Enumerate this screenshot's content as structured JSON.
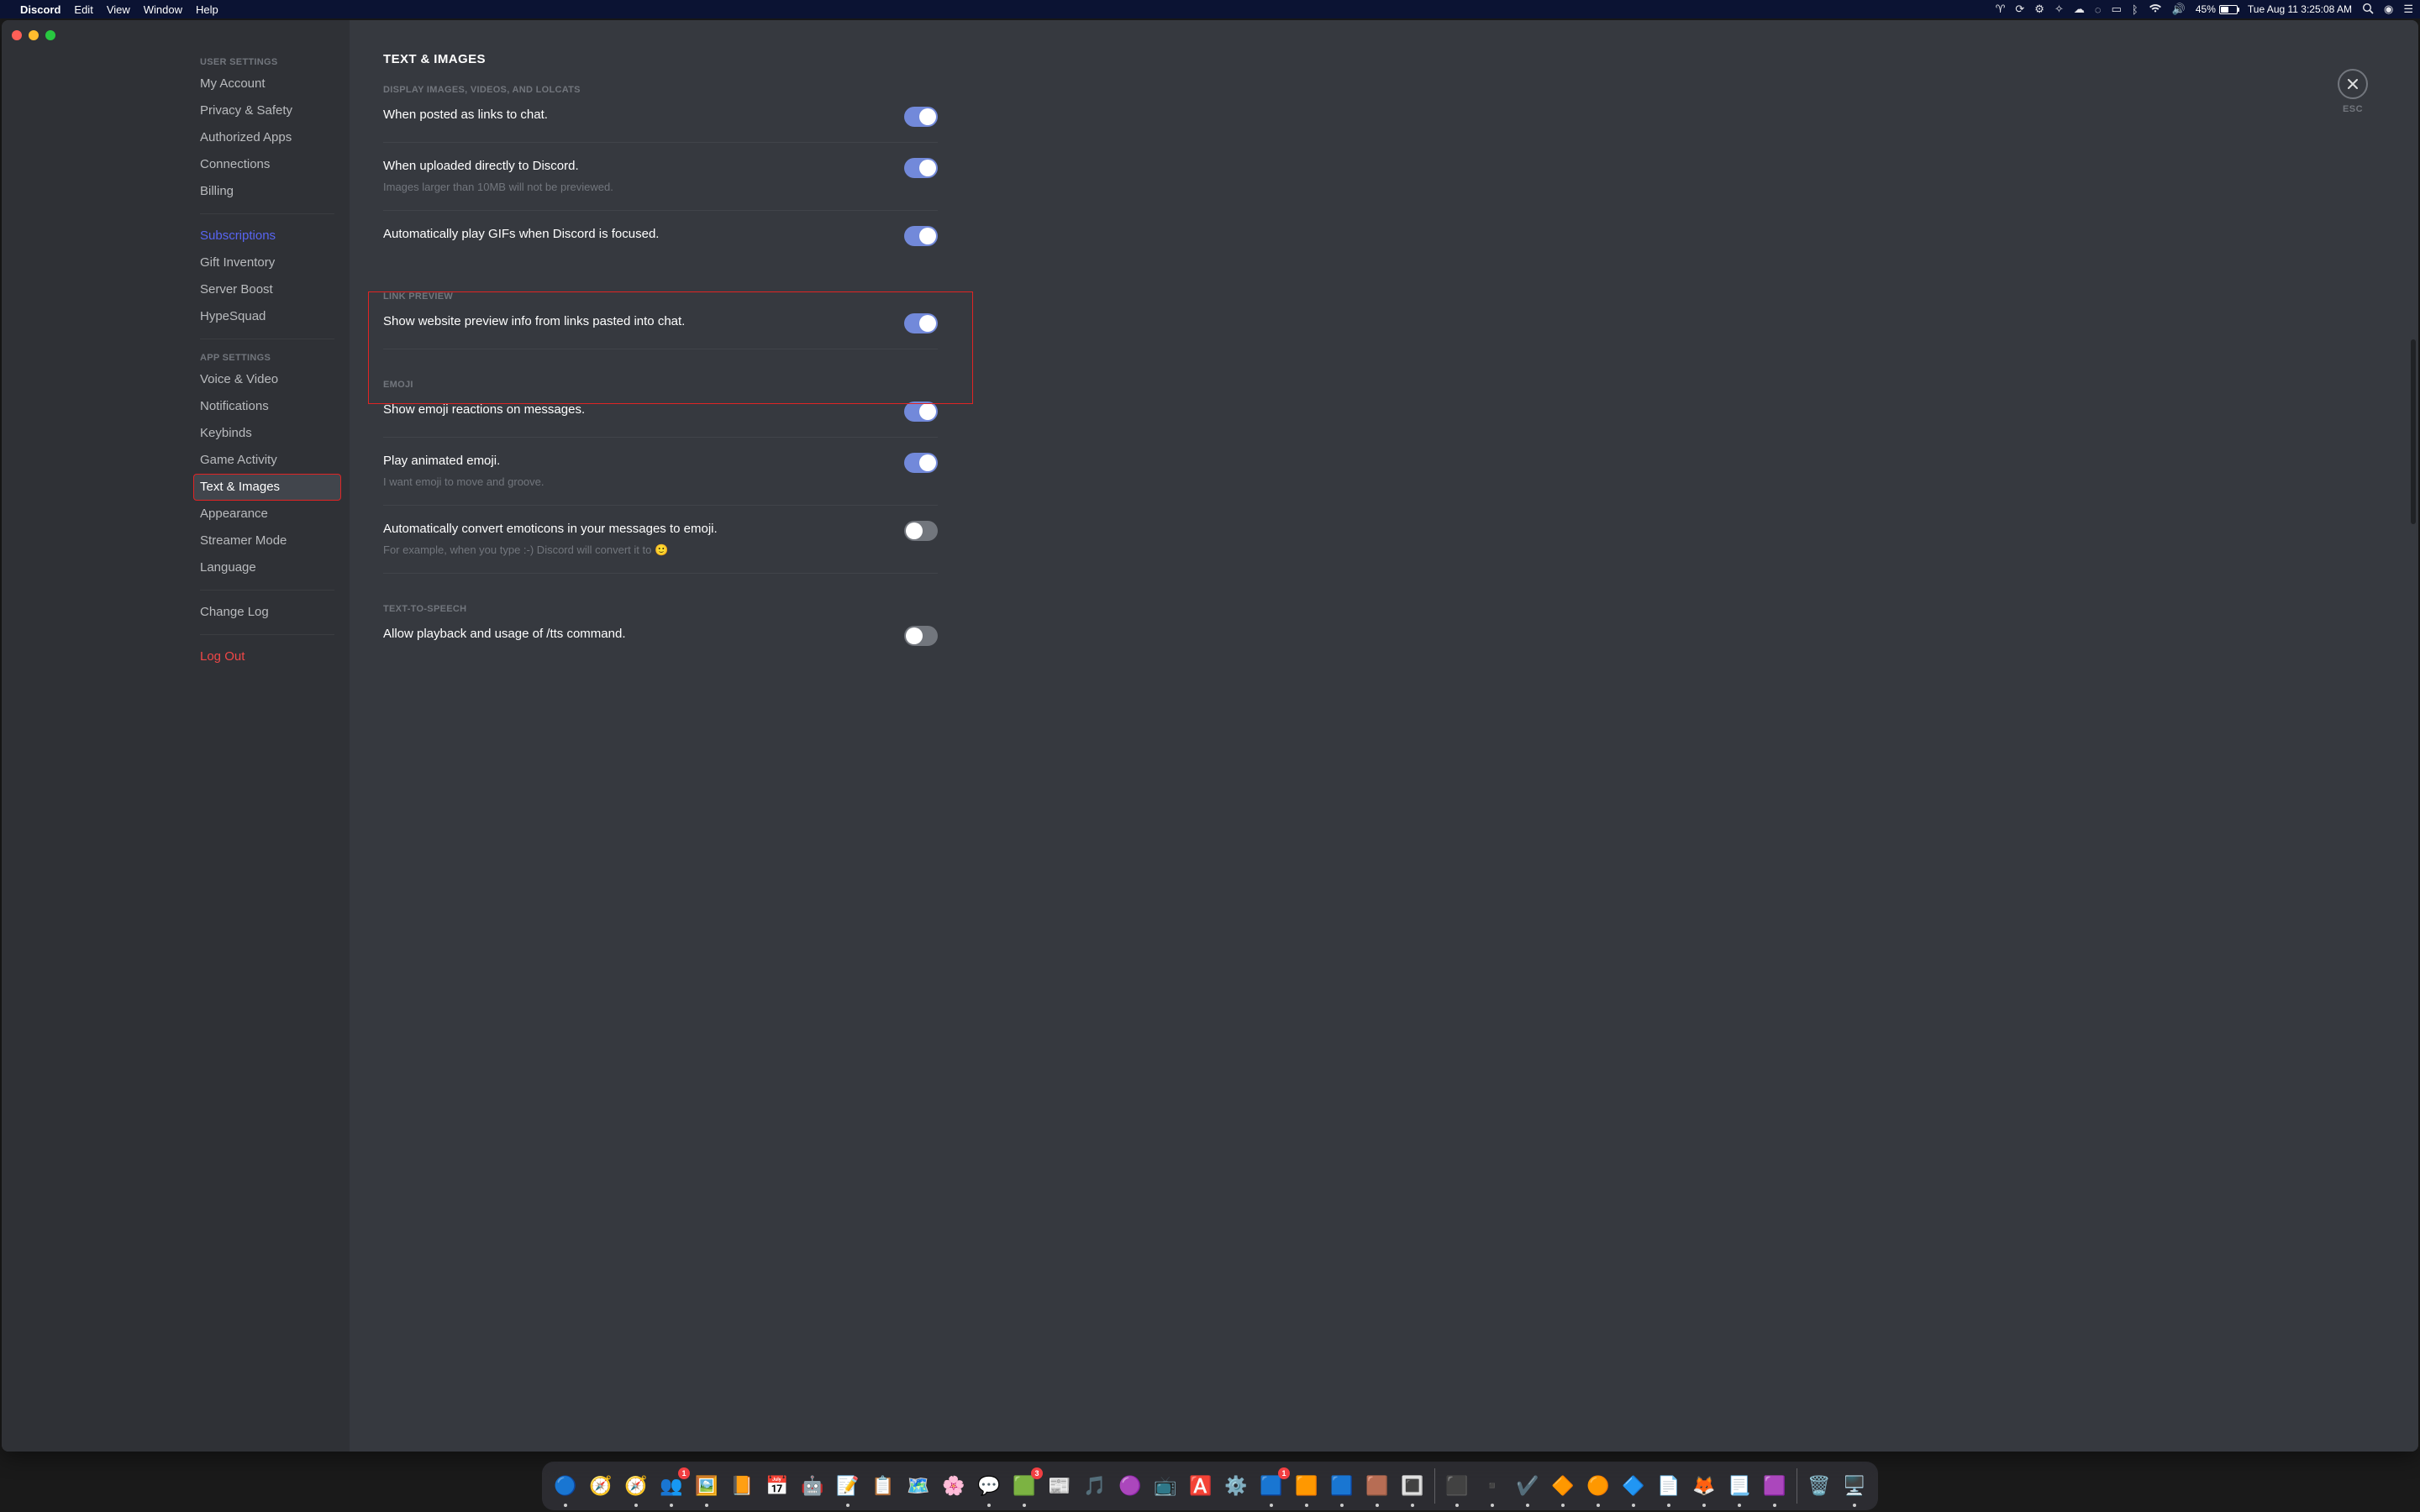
{
  "menubar": {
    "app": "Discord",
    "menus": [
      "Edit",
      "View",
      "Window",
      "Help"
    ],
    "battery": "45%",
    "clock": "Tue Aug 11  3:25:08 AM",
    "status_icons": [
      "vpn",
      "sync",
      "settings-badge",
      "cloud",
      "display-rec",
      "screen-mirror",
      "bluetooth",
      "wifi",
      "volume"
    ]
  },
  "close": {
    "esc": "ESC"
  },
  "sidebar": {
    "user_header": "USER SETTINGS",
    "user_items": [
      "My Account",
      "Privacy & Safety",
      "Authorized Apps",
      "Connections",
      "Billing"
    ],
    "subscriptions": "Subscriptions",
    "billing_items": [
      "Gift Inventory",
      "Server Boost",
      "HypeSquad"
    ],
    "app_header": "APP SETTINGS",
    "app_items": [
      "Voice & Video",
      "Notifications",
      "Keybinds",
      "Game Activity",
      "Text & Images",
      "Appearance",
      "Streamer Mode",
      "Language"
    ],
    "changelog": "Change Log",
    "logout": "Log Out"
  },
  "page": {
    "title": "TEXT & IMAGES",
    "s1_header": "DISPLAY IMAGES, VIDEOS, AND LOLCATS",
    "s1a": "When posted as links to chat.",
    "s1b": "When uploaded directly to Discord.",
    "s1b_desc": "Images larger than 10MB will not be previewed.",
    "s1c": "Automatically play GIFs when Discord is focused.",
    "s2_header": "LINK PREVIEW",
    "s2a": "Show website preview info from links pasted into chat.",
    "s3_header": "EMOJI",
    "s3a": "Show emoji reactions on messages.",
    "s3b": "Play animated emoji.",
    "s3b_desc": "I want emoji to move and groove.",
    "s3c": "Automatically convert emoticons in your messages to emoji.",
    "s3c_desc": "For example, when you type :-) Discord will convert it to 🙂",
    "s4_header": "TEXT-TO-SPEECH",
    "s4a": "Allow playback and usage of /tts command."
  },
  "dock": {
    "items": [
      {
        "n": "finder",
        "e": "🔵",
        "r": true
      },
      {
        "n": "safari-tech",
        "e": "🧭",
        "r": false
      },
      {
        "n": "safari",
        "e": "🧭",
        "r": true
      },
      {
        "n": "teams",
        "e": "👥",
        "r": true,
        "b": "1"
      },
      {
        "n": "preview",
        "e": "🖼️",
        "r": true
      },
      {
        "n": "books",
        "e": "📙",
        "r": false
      },
      {
        "n": "calendar",
        "e": "📅",
        "r": false
      },
      {
        "n": "automator",
        "e": "🤖",
        "r": false
      },
      {
        "n": "notes",
        "e": "📝",
        "r": true
      },
      {
        "n": "reminders",
        "e": "📋",
        "r": false
      },
      {
        "n": "maps",
        "e": "🗺️",
        "r": false
      },
      {
        "n": "photos",
        "e": "🌸",
        "r": false
      },
      {
        "n": "messages",
        "e": "💬",
        "r": true
      },
      {
        "n": "slack",
        "e": "🟩",
        "r": true,
        "b": "3"
      },
      {
        "n": "news",
        "e": "📰",
        "r": false
      },
      {
        "n": "music",
        "e": "🎵",
        "r": false
      },
      {
        "n": "podcasts",
        "e": "🟣",
        "r": false
      },
      {
        "n": "tv",
        "e": "📺",
        "r": false
      },
      {
        "n": "appstore",
        "e": "🅰️",
        "r": false
      },
      {
        "n": "sysprefs",
        "e": "⚙️",
        "r": false
      },
      {
        "n": "app-1",
        "e": "🟦",
        "r": true,
        "b": "1"
      },
      {
        "n": "app-2",
        "e": "🟧",
        "r": true
      },
      {
        "n": "app-3",
        "e": "🟦",
        "r": true
      },
      {
        "n": "minecraft",
        "e": "🟫",
        "r": true
      },
      {
        "n": "app-w",
        "e": "🔳",
        "r": true
      },
      {
        "n": "terminal",
        "e": "⬛",
        "r": true
      },
      {
        "n": "terminal2",
        "e": "▪️",
        "r": true
      },
      {
        "n": "vpn-app",
        "e": "✔️",
        "r": true
      },
      {
        "n": "figma",
        "e": "🔶",
        "r": true
      },
      {
        "n": "app-o",
        "e": "🟠",
        "r": true
      },
      {
        "n": "app-v",
        "e": "🔷",
        "r": true
      },
      {
        "n": "textedit",
        "e": "📄",
        "r": true
      },
      {
        "n": "firefox",
        "e": "🦊",
        "r": true
      },
      {
        "n": "notepad",
        "e": "📃",
        "r": true
      },
      {
        "n": "discord",
        "e": "🟪",
        "r": true
      },
      {
        "n": "trash",
        "e": "🗑️",
        "r": false
      },
      {
        "n": "displays",
        "e": "🖥️",
        "r": true
      }
    ],
    "sep_after": [
      24,
      34
    ]
  }
}
